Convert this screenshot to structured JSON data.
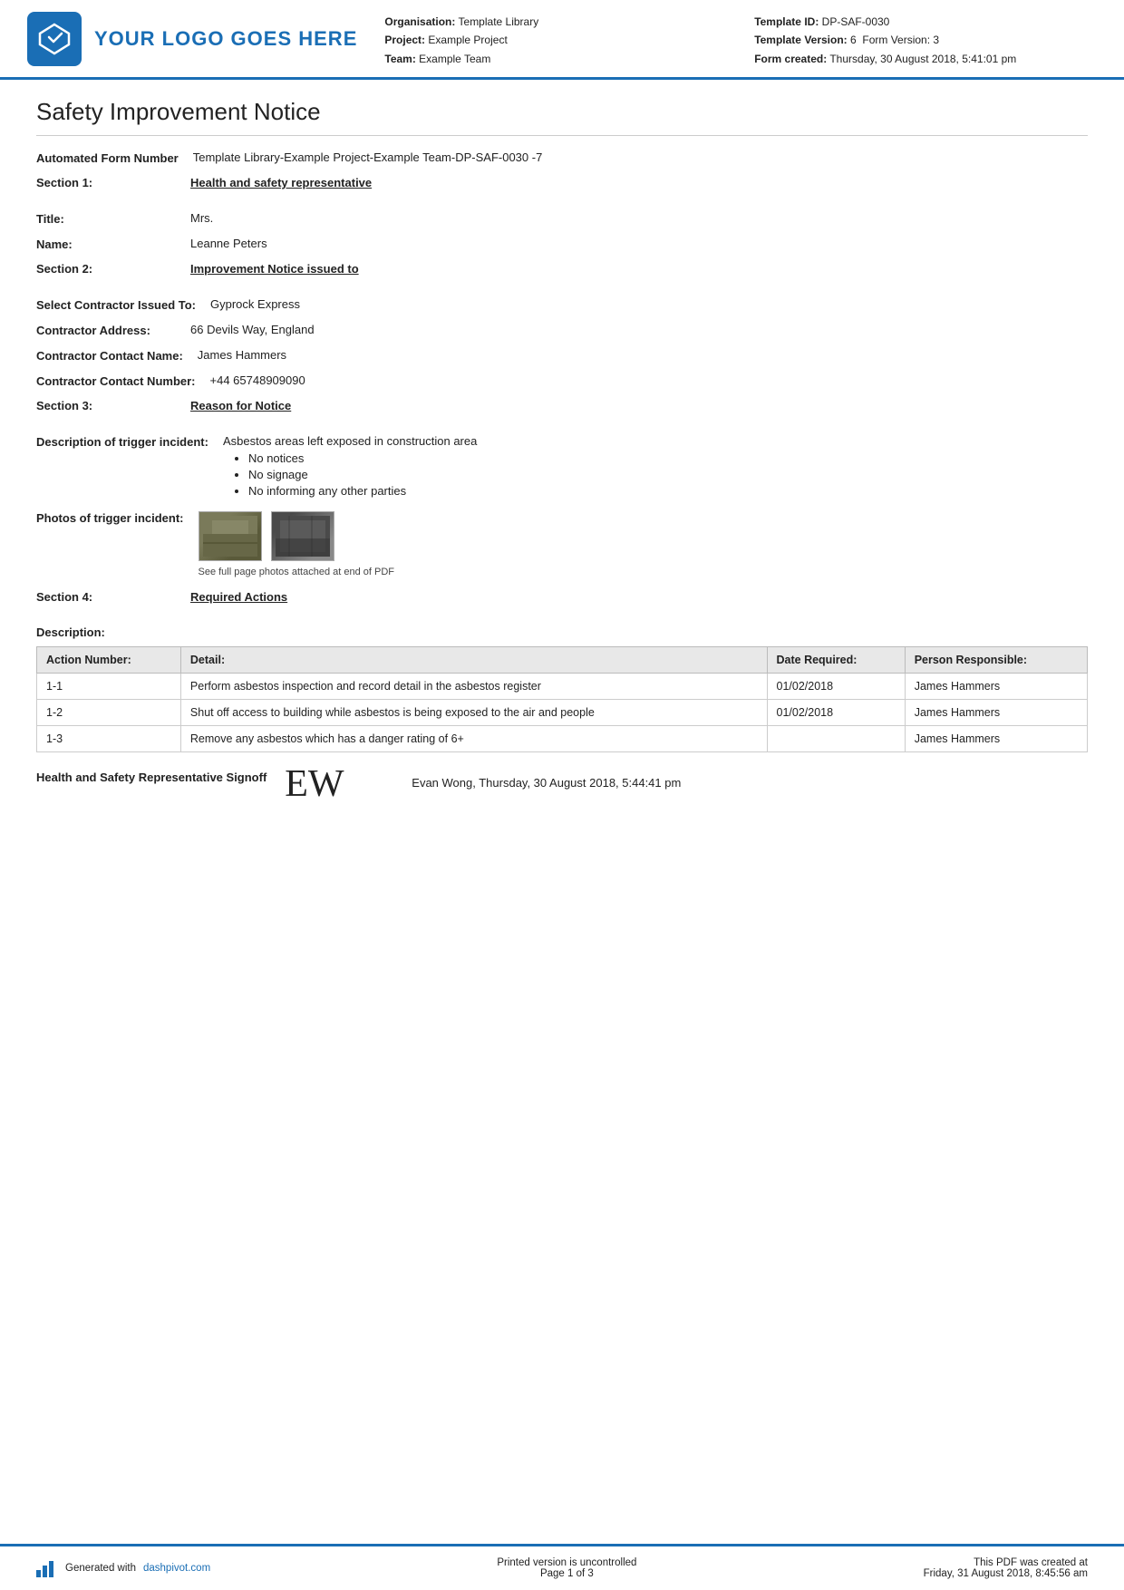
{
  "header": {
    "logo_text": "YOUR LOGO GOES HERE",
    "org_label": "Organisation:",
    "org_value": "Template Library",
    "project_label": "Project:",
    "project_value": "Example Project",
    "team_label": "Team:",
    "team_value": "Example Team",
    "template_id_label": "Template ID:",
    "template_id_value": "DP-SAF-0030",
    "template_version_label": "Template Version:",
    "template_version_value": "6",
    "form_version_label": "Form Version:",
    "form_version_value": "3",
    "form_created_label": "Form created:",
    "form_created_value": "Thursday, 30 August 2018, 5:41:01 pm"
  },
  "document": {
    "title": "Safety Improvement Notice",
    "form_number_label": "Automated Form Number",
    "form_number_value": "Template Library-Example Project-Example Team-DP-SAF-0030   -7"
  },
  "section1": {
    "label": "Section 1:",
    "heading": "Health and safety representative",
    "title_label": "Title:",
    "title_value": "Mrs.",
    "name_label": "Name:",
    "name_value": "Leanne Peters"
  },
  "section2": {
    "label": "Section 2:",
    "heading": "Improvement Notice issued to",
    "contractor_label": "Select Contractor Issued To:",
    "contractor_value": "Gyprock Express",
    "address_label": "Contractor Address:",
    "address_value": "66 Devils Way, England",
    "contact_name_label": "Contractor Contact Name:",
    "contact_name_value": "James Hammers",
    "contact_number_label": "Contractor Contact Number:",
    "contact_number_value": "+44 65748909090"
  },
  "section3": {
    "label": "Section 3:",
    "heading": "Reason for Notice",
    "description_label": "Description of trigger incident:",
    "description_value": "Asbestos areas left exposed in construction area",
    "bullets": [
      "No notices",
      "No signage",
      "No informing any other parties"
    ],
    "photos_label": "Photos of trigger incident:",
    "photos_caption": "See full page photos attached at end of PDF"
  },
  "section4": {
    "label": "Section 4:",
    "heading": "Required Actions",
    "desc_label": "Description:",
    "table": {
      "headers": [
        "Action Number:",
        "Detail:",
        "Date Required:",
        "Person Responsible:"
      ],
      "rows": [
        {
          "action_number": "1-1",
          "detail": "Perform asbestos inspection and record detail in the asbestos register",
          "date_required": "01/02/2018",
          "person": "James Hammers"
        },
        {
          "action_number": "1-2",
          "detail": "Shut off access to building while asbestos is being exposed to the air and people",
          "date_required": "01/02/2018",
          "person": "James Hammers"
        },
        {
          "action_number": "1-3",
          "detail": "Remove any asbestos which has a danger rating of 6+",
          "date_required": "",
          "person": "James Hammers"
        }
      ]
    }
  },
  "signoff": {
    "label": "Health and Safety Representative Signoff",
    "signature": "EW",
    "meta": "Evan Wong, Thursday, 30 August 2018, 5:44:41 pm"
  },
  "footer": {
    "generated_text": "Generated with ",
    "generated_link": "dashpivot.com",
    "uncontrolled": "Printed version is uncontrolled",
    "page_info": "Page 1 of 3",
    "pdf_created": "This PDF was created at",
    "pdf_created_date": "Friday, 31 August 2018, 8:45:56 am",
    "page_of": "of 3"
  }
}
